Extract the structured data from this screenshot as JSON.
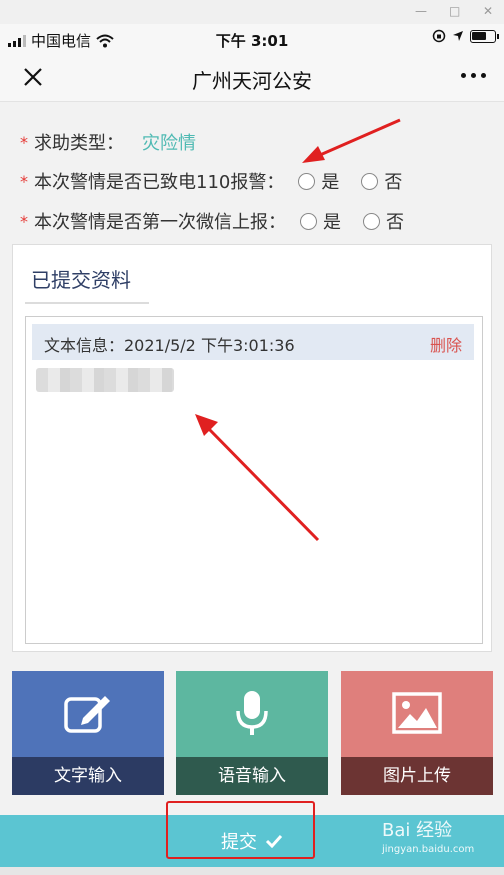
{
  "status_bar": {
    "carrier": "中国电信",
    "time": "下午 3:01"
  },
  "nav": {
    "title": "广州天河公安"
  },
  "form": {
    "type_label": "求助类型：",
    "type_value": "灾险情",
    "q1_label": "本次警情是否已致电110报警：",
    "q2_label": "本次警情是否第一次微信上报：",
    "yes": "是",
    "no": "否",
    "required_mark": "*"
  },
  "submitted": {
    "title": "已提交资料",
    "entry_label": "文本信息：2021/5/2 下午3:01:36",
    "delete_label": "删除"
  },
  "input_buttons": [
    {
      "label": "文字输入",
      "icon": "edit-icon"
    },
    {
      "label": "语音输入",
      "icon": "microphone-icon"
    },
    {
      "label": "图片上传",
      "icon": "image-icon"
    }
  ],
  "submit": {
    "label": "提交"
  },
  "watermark": {
    "text": "Bai 经验",
    "url": "jingyan.baidu.com"
  },
  "colors": {
    "accent_teal": "#4fbab3",
    "submit_bar": "#5bc5d2",
    "text_input": "#4f73b9",
    "voice_input": "#5db7a0",
    "image_upload": "#df7f7c",
    "annotation_red": "#e02020"
  }
}
